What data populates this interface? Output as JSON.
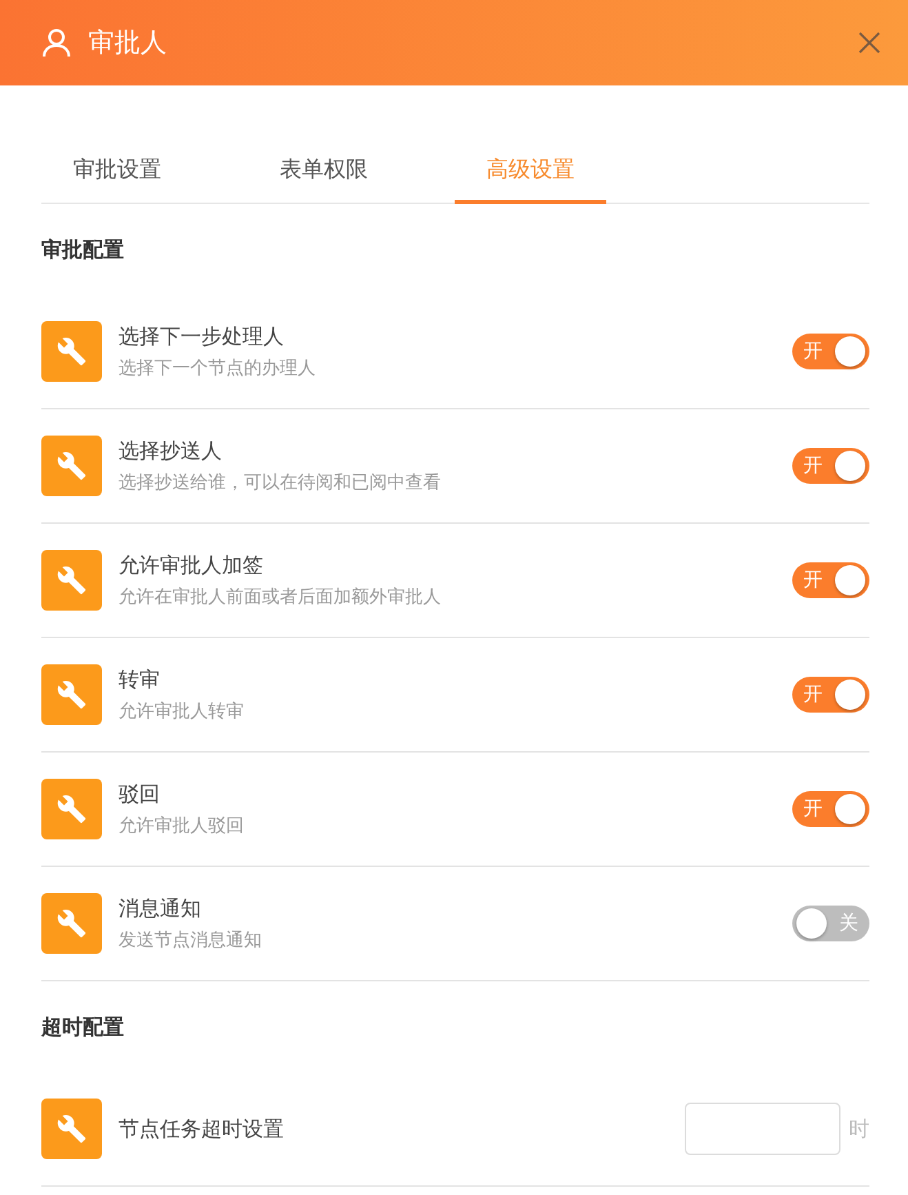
{
  "window": {
    "title": "审批人"
  },
  "tabs": [
    {
      "label": "审批设置",
      "selected": false
    },
    {
      "label": "表单权限",
      "selected": false
    },
    {
      "label": "高级设置",
      "selected": true
    }
  ],
  "sections": [
    {
      "title": "审批配置",
      "rows": [
        {
          "kind": "toggle",
          "title": "选择下一步处理人",
          "description": "选择下一个节点的办理人",
          "on": true,
          "toggle_label": "开"
        },
        {
          "kind": "toggle",
          "title": "选择抄送人",
          "description": "选择抄送给谁，可以在待阅和已阅中查看",
          "on": true,
          "toggle_label": "开"
        },
        {
          "kind": "toggle",
          "title": "允许审批人加签",
          "description": "允许在审批人前面或者后面加额外审批人",
          "on": true,
          "toggle_label": "开"
        },
        {
          "kind": "toggle",
          "title": "转审",
          "description": "允许审批人转审",
          "on": true,
          "toggle_label": "开"
        },
        {
          "kind": "toggle",
          "title": "驳回",
          "description": "允许审批人驳回",
          "on": true,
          "toggle_label": "开"
        },
        {
          "kind": "toggle",
          "title": "消息通知",
          "description": "发送节点消息通知",
          "on": false,
          "toggle_label": "关"
        }
      ]
    },
    {
      "title": "超时配置",
      "rows": [
        {
          "kind": "input",
          "title": "节点任务超时设置",
          "unit": "时"
        }
      ]
    }
  ]
}
